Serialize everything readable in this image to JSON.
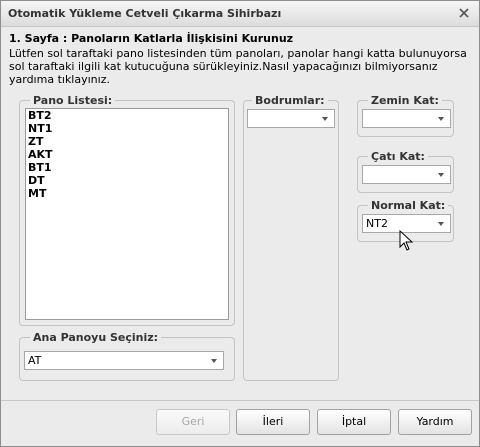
{
  "window": {
    "title": "Otomatik Yükleme Cetveli Çıkarma Sihirbazı"
  },
  "page": {
    "header": "1. Sayfa : Panoların Katlarla İlişkisini Kurunuz",
    "description": "Lütfen sol taraftaki pano listesinden tüm panoları, panolar hangi katta bulunuyorsa sol taraftaki ilgili kat kutucuğuna sürükleyiniz.Nasıl yapacağınızı bilmiyorsanız yardıma tıklayınız."
  },
  "pano_listesi": {
    "label": "Pano Listesi:",
    "items": [
      "BT2",
      "NT1",
      "ZT",
      "AKT",
      "BT1",
      "DT",
      "MT"
    ]
  },
  "ana_pano": {
    "label": "Ana Panoyu Seçiniz:",
    "value": "AT"
  },
  "bodrumlar": {
    "label": "Bodrumlar:",
    "value": ""
  },
  "zemin_kat": {
    "label": "Zemin Kat:",
    "value": ""
  },
  "cati_kat": {
    "label": "Çatı Kat:",
    "value": ""
  },
  "normal_kat": {
    "label": "Normal Kat:",
    "value": "NT2"
  },
  "buttons": {
    "back": "Geri",
    "next": "İleri",
    "cancel": "İptal",
    "help": "Yardım"
  },
  "icons": {
    "close": "close-icon",
    "cursor": "mouse-pointer-icon",
    "dropdown": "chevron-down-icon"
  }
}
